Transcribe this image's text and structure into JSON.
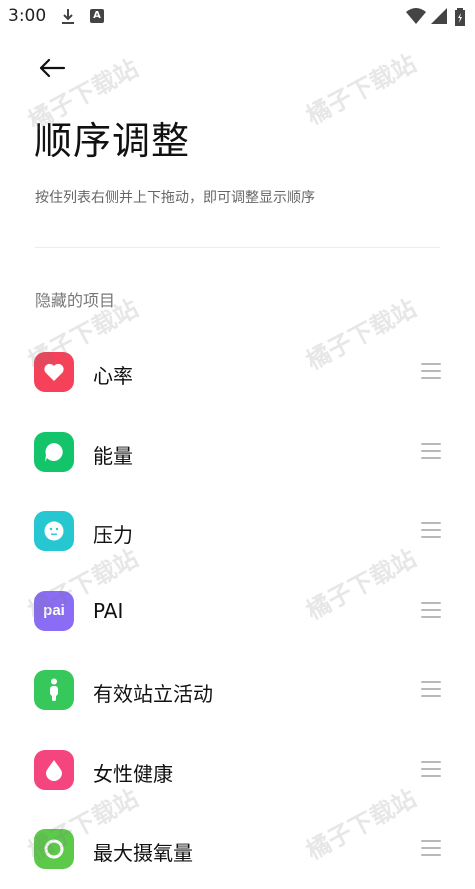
{
  "status_bar": {
    "time": "3:00",
    "a_badge": "A"
  },
  "header": {
    "title": "顺序调整",
    "description": "按住列表右侧并上下拖动，即可调整显示顺序"
  },
  "section_title": "隐藏的项目",
  "items": [
    {
      "label": "心率",
      "icon": "heart-icon",
      "color": "#f5415a"
    },
    {
      "label": "能量",
      "icon": "energy-icon",
      "color": "#13c46a"
    },
    {
      "label": "压力",
      "icon": "stress-face-icon",
      "color": "#27c7d2"
    },
    {
      "label": "PAI",
      "icon": "pai-icon",
      "color": "#8a6cf5",
      "icon_text": "pai"
    },
    {
      "label": "有效站立活动",
      "icon": "standing-person-icon",
      "color": "#36c85b"
    },
    {
      "label": "女性健康",
      "icon": "drop-icon",
      "color": "#f4457f"
    },
    {
      "label": "最大摄氧量",
      "icon": "oxygen-icon",
      "color": "#5cc94a"
    }
  ],
  "watermark": "橘子下载站",
  "colors": {
    "drag_handle": "#b9b9b9",
    "divider": "#ececec"
  }
}
